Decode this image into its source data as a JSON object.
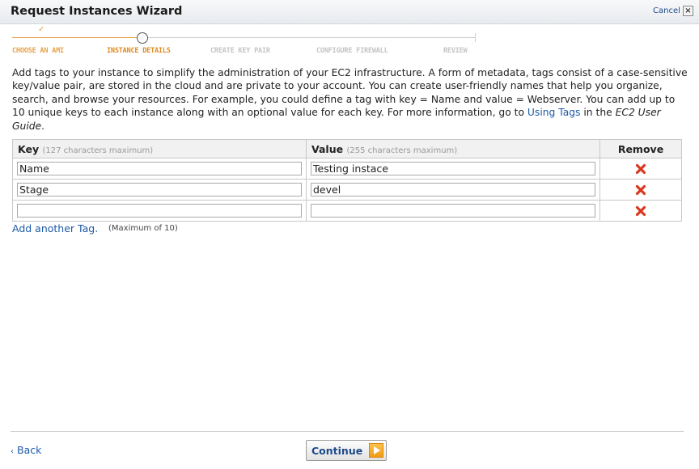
{
  "window": {
    "title": "Request Instances Wizard",
    "cancel_label": "Cancel",
    "close_glyph": "×"
  },
  "steps": [
    {
      "label": "CHOOSE AN AMI",
      "state": "done"
    },
    {
      "label": "INSTANCE DETAILS",
      "state": "current"
    },
    {
      "label": "CREATE KEY PAIR",
      "state": "todo"
    },
    {
      "label": "CONFIGURE FIREWALL",
      "state": "todo"
    },
    {
      "label": "REVIEW",
      "state": "todo"
    }
  ],
  "description": {
    "text": "Add tags to your instance to simplify the administration of your EC2 infrastructure. A form of metadata, tags consist of a case-sensitive key/value pair, are stored in the cloud and are private to your account. You can create user-friendly names that help you organize, search, and browse your resources. For example, you could define a tag with key = Name and value = Webserver. You can add up to 10 unique keys to each instance along with an optional value for each key. For more information, go to ",
    "link_text": "Using Tags",
    "text_after_link": " in the ",
    "guide_name": "EC2 User Guide",
    "text_end": "."
  },
  "table": {
    "key_header": "Key",
    "key_hint": "(127 characters maximum)",
    "value_header": "Value",
    "value_hint": "(255 characters maximum)",
    "remove_header": "Remove",
    "rows": [
      {
        "key": "Name",
        "value": "Testing instace"
      },
      {
        "key": "Stage",
        "value": "devel"
      },
      {
        "key": "",
        "value": ""
      }
    ]
  },
  "add_tag": {
    "label": "Add another Tag.",
    "note": "(Maximum of 10)"
  },
  "footer": {
    "back_chevron": "‹",
    "back_label": "Back",
    "continue_label": "Continue"
  },
  "colors": {
    "step_done": "#e6a24c",
    "link": "#1d5aa8",
    "remove_icon": "#d9381e"
  },
  "icons": {
    "remove": "red-x-icon",
    "continue": "orange-play-arrow-icon",
    "step_done": "check-icon"
  }
}
